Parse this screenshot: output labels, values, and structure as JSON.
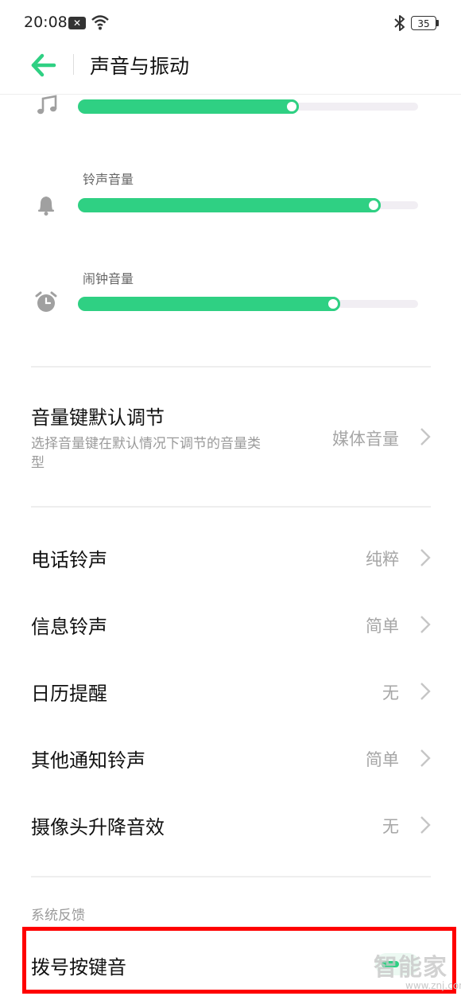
{
  "status_bar": {
    "time": "20:08",
    "battery": "35"
  },
  "header": {
    "title": "声音与振动"
  },
  "volumes": [
    {
      "label": "",
      "icon": "music-note-icon",
      "level": 0.65
    },
    {
      "label": "铃声音量",
      "icon": "bell-icon",
      "level": 0.89
    },
    {
      "label": "闹钟音量",
      "icon": "alarm-clock-icon",
      "level": 0.77
    }
  ],
  "volume_key": {
    "title": "音量键默认调节",
    "subtitle_line1": "选择音量键在默认情况下调节的音量类",
    "subtitle_line2": "型",
    "value": "媒体音量"
  },
  "rows": [
    {
      "title": "电话铃声",
      "value": "纯粹"
    },
    {
      "title": "信息铃声",
      "value": "简单"
    },
    {
      "title": "日历提醒",
      "value": "无"
    },
    {
      "title": "其他通知铃声",
      "value": "简单"
    },
    {
      "title": "摄像头升降音效",
      "value": "无"
    }
  ],
  "system_feedback": {
    "section_title": "系统反馈",
    "dial_pad_tone": "拨号按键音"
  },
  "watermark": {
    "text": "智能家",
    "url": "www.znj.com"
  },
  "colors": {
    "accent": "#2fd083",
    "highlight": "#ff0000"
  }
}
